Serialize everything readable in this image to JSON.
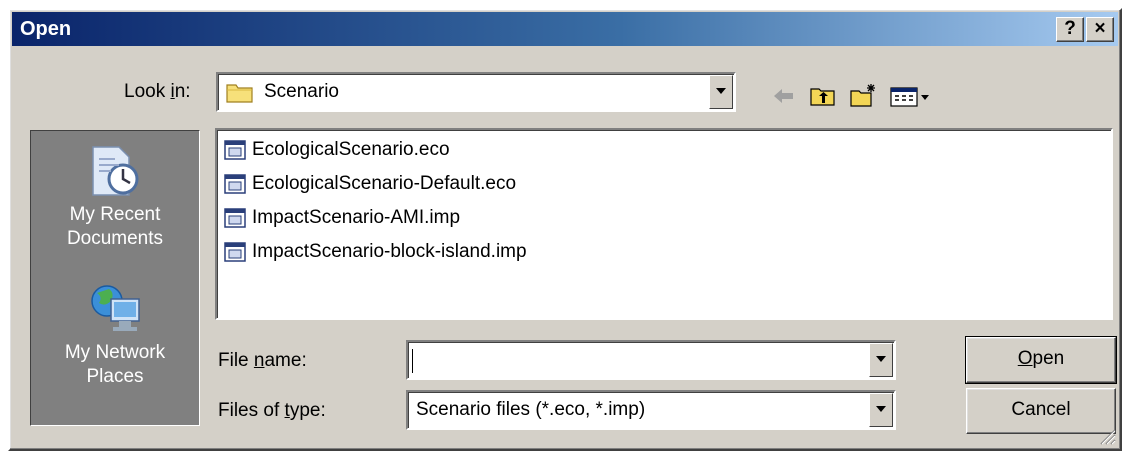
{
  "window": {
    "title": "Open",
    "help_label": "?",
    "close_label": "×"
  },
  "lookin": {
    "label_pre": "Look ",
    "label_mn": "i",
    "label_post": "n:",
    "value": "Scenario"
  },
  "toolbar": {
    "icons": [
      "back-arrow-icon",
      "up-one-level-icon",
      "new-folder-icon",
      "view-menu-icon"
    ]
  },
  "places": [
    {
      "line1": "My Recent",
      "line2": "Documents",
      "icon": "recent-documents-icon"
    },
    {
      "line1": "My Network",
      "line2": "Places",
      "icon": "network-places-icon"
    }
  ],
  "files": [
    "EcologicalScenario.eco",
    "EcologicalScenario-Default.eco",
    "ImpactScenario-AMI.imp",
    "ImpactScenario-block-island.imp"
  ],
  "filename": {
    "label_pre": "File ",
    "label_mn": "n",
    "label_post": "ame:",
    "value": ""
  },
  "filetype": {
    "label_pre": "Files of ",
    "label_mn": "t",
    "label_post": "ype:",
    "value": "Scenario files (*.eco, *.imp)"
  },
  "buttons": {
    "open_mn": "O",
    "open_rest": "pen",
    "cancel": "Cancel"
  },
  "colors": {
    "title_start": "#0a246a",
    "title_end": "#a6caf0",
    "face": "#d4d0c8"
  }
}
